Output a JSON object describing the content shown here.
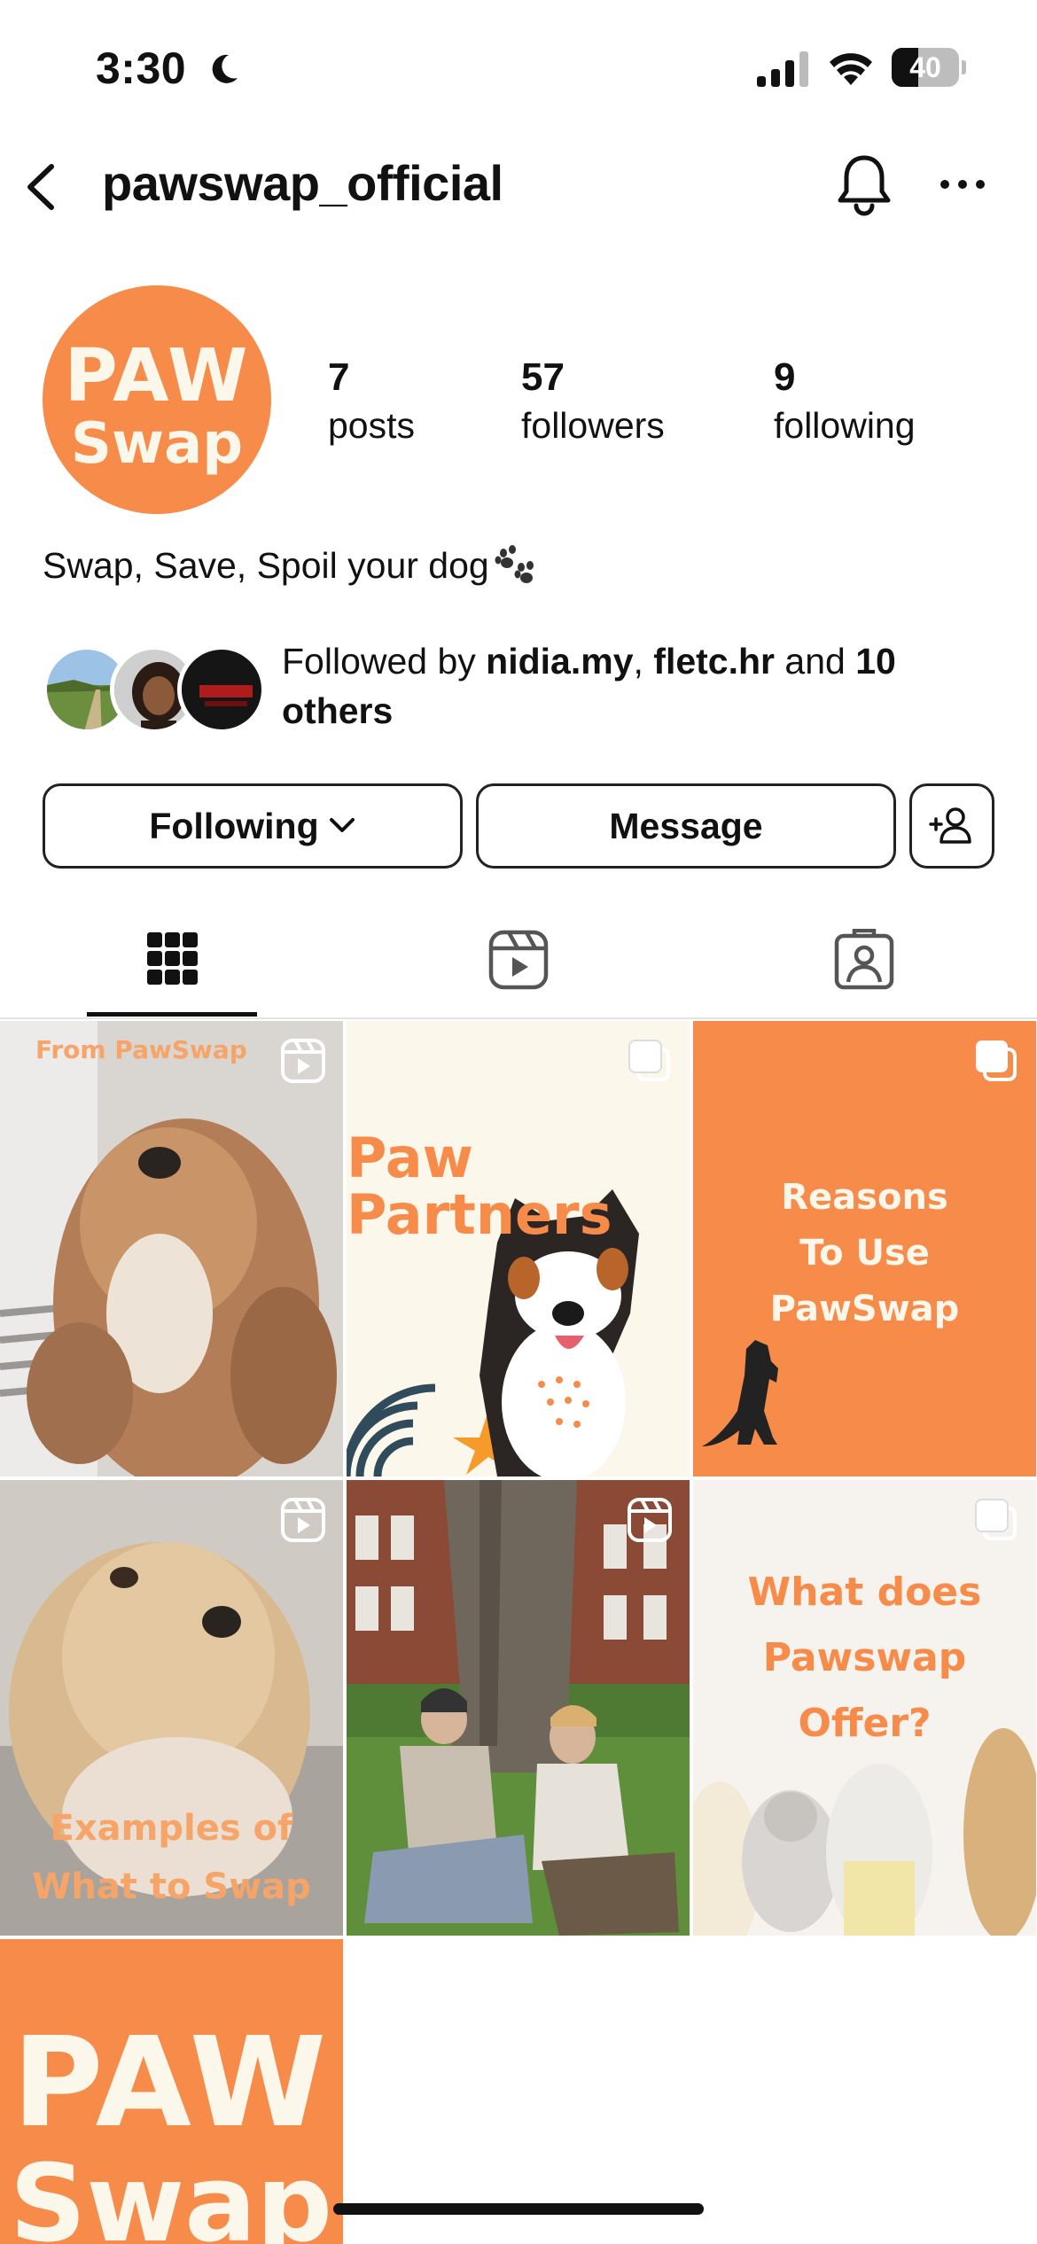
{
  "status_bar": {
    "time": "3:30",
    "battery": "40",
    "battery_level": 0.4
  },
  "header": {
    "username": "pawswap_official"
  },
  "profile": {
    "avatar_line1": "PAW",
    "avatar_line2": "Swap",
    "stats": [
      {
        "value": "7",
        "label": "posts"
      },
      {
        "value": "57",
        "label": "followers"
      },
      {
        "value": "9",
        "label": "following"
      }
    ],
    "bio": "Swap, Save, Spoil your dog"
  },
  "followed_by": {
    "prefix": "Followed by ",
    "user1": "nidia.my",
    "sep": ", ",
    "user2": "fletc.hr",
    "mid": " and ",
    "count": "10 others"
  },
  "buttons": {
    "following": "Following",
    "message": "Message"
  },
  "tabs": [
    "grid-icon",
    "reels-icon",
    "tagged-icon"
  ],
  "posts": [
    {
      "type": "reel",
      "text": "From PawSwap"
    },
    {
      "type": "carousel",
      "text_line1": "Paw",
      "text_line2": "Partners"
    },
    {
      "type": "carousel",
      "text": "Reasons\nTo Use\nPawSwap"
    },
    {
      "type": "reel",
      "text": "Examples of\nWhat to Swap"
    },
    {
      "type": "reel",
      "text": ""
    },
    {
      "type": "carousel",
      "text": "What does\nPawswap\nOffer?"
    },
    {
      "type": "post",
      "text_line1": "PAW",
      "text_line2": "Swap"
    }
  ],
  "colors": {
    "brand_orange": "#f68b4a",
    "cream": "#fbf7ea",
    "text": "#111111"
  }
}
